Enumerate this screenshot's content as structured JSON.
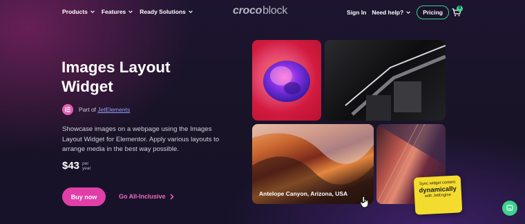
{
  "nav": {
    "items": [
      {
        "label": "Products"
      },
      {
        "label": "Features"
      },
      {
        "label": "Ready Solutions"
      }
    ],
    "logo": {
      "part1": "croco",
      "part2": "block"
    },
    "sign_in": "Sign In",
    "help": "Need help?",
    "pricing": "Pricing",
    "cart_count": "0"
  },
  "hero": {
    "title": "Images Layout Widget",
    "part_of_prefix": "Part of",
    "part_of_link": "JetElements",
    "description": "Showcase images on a webpage using the Images Layout Widget for Elementor. Apply various layouts to arrange media in the best way possible.",
    "price": "$43",
    "price_per_1": "per",
    "price_per_2": "year",
    "buy_label": "Buy now",
    "all_inclusive_label": "Go All-Inclusive"
  },
  "gallery": {
    "caption": "Antelope Canyon, Arizona, USA",
    "sync_line1": "Sync widget content",
    "sync_line2": "dynamically",
    "sync_line3": "with JetEngine"
  },
  "colors": {
    "accent_pink": "#e13ea8",
    "accent_green": "#3fd18d",
    "link_blue": "#8ea2ff",
    "sticker_yellow": "#f4dc2f"
  }
}
